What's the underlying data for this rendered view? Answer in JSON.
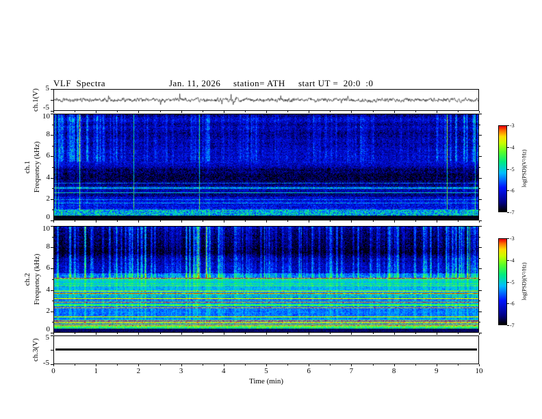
{
  "figure": {
    "title": "VLF  Spectra",
    "date": "Jan. 11, 2026",
    "station_label": "station= ATH",
    "start_ut_label": "start UT =  20:0  :0"
  },
  "axes": {
    "time": {
      "label": "Time (min)",
      "min": 0,
      "max": 10,
      "major_ticks": [
        0,
        1,
        2,
        3,
        4,
        5,
        6,
        7,
        8,
        9,
        10
      ],
      "minor_step": 0.5
    },
    "frequency": {
      "label": "Frequency (kHz)",
      "min": 0,
      "max": 10,
      "major_ticks": [
        0,
        2,
        4,
        6,
        8,
        10
      ],
      "minor_ticks": [
        1,
        3,
        5,
        7,
        9
      ]
    },
    "voltage": {
      "min": -5,
      "max": 5,
      "max_label": "5",
      "min_label": "-5"
    }
  },
  "panels": {
    "ch1_wave": {
      "ylabel": "ch.1(V)"
    },
    "ch1_spec": {
      "ylabel_channel": "ch.1",
      "ylabel_axis": "Frequency (kHz)"
    },
    "ch2_spec": {
      "ylabel_channel": "ch.2",
      "ylabel_axis": "Frequency (kHz)"
    },
    "ch3_wave": {
      "ylabel": "ch.3(V)"
    }
  },
  "colorbar": {
    "label": "log(PSD)(V²/Hz)",
    "max": -3,
    "min": -7,
    "ticks": [
      -3,
      -4,
      -5,
      -6,
      -7
    ]
  },
  "chart_data": [
    {
      "panel": "ch.1(V) waveform",
      "type": "line",
      "xlabel": "Time (min)",
      "xlim": [
        0,
        10
      ],
      "ylabel": "ch.1(V)",
      "ylim": [
        -5,
        5
      ],
      "series": [
        {
          "name": "ch.1 voltage",
          "summary": "zero-mean broadband noise, typical amplitude about ±1 V, with frequent impulsive sferic spikes reaching ±3 to ±5 V; dense spike cluster near t≈4.2 min"
        }
      ]
    },
    {
      "panel": "ch.1 spectrogram",
      "type": "heatmap",
      "xlabel": "Time (min)",
      "xlim": [
        0,
        10
      ],
      "ylabel": "Frequency (kHz)",
      "ylim": [
        0,
        10
      ],
      "zlabel": "log(PSD)(V²/Hz)",
      "zlim": [
        -7,
        -3
      ],
      "features": [
        "very dark background (≈ -6.8) above ~5.5 kHz pierced by dense vertical sferic streaks reaching ≈ -4.5 (cyan/green)",
        "blue background (≈ -6.3) from 1–5.5 kHz with a darker navy band 3–5.5 kHz and scattered cyan-green speckle (≈ -5.5)",
        "a few thin bright horizontal lines between 1.5 and 5 kHz",
        "bright green speckled band near 0.5–0.9 kHz (≈ -5.2)",
        "solid black band (≈ -7) below ~0.4 kHz"
      ]
    },
    {
      "panel": "ch.2 spectrogram",
      "type": "heatmap",
      "xlabel": "Time (min)",
      "xlim": [
        0,
        10
      ],
      "ylabel": "Frequency (kHz)",
      "ylim": [
        0,
        10
      ],
      "zlabel": "log(PSD)(V²/Hz)",
      "zlim": [
        -7,
        -3
      ],
      "features": [
        "very dark background above ~5 kHz with the same dense vertical sferic streaks as ch.1",
        "0.5–5 kHz filled with horizontal harmonic lines in green/yellow/orange (≈ -5 to -3.8) over a cyan-green noisy background",
        "several intense red/orange lines (≈ -3.3) between 0.6 and 4 kHz",
        "bright green line near 0.4–0.5 kHz",
        "dark band (≈ -6.8) below ~0.3 kHz"
      ]
    },
    {
      "panel": "ch.3(V) waveform",
      "type": "line",
      "xlabel": "Time (min)",
      "xlim": [
        0,
        10
      ],
      "ylabel": "ch.3(V)",
      "ylim": [
        -5,
        5
      ],
      "constant_value": 0,
      "series": [
        {
          "name": "ch.3 voltage",
          "summary": "constant 0 V for the whole record, drawn as a thick black flat line (channel inactive)"
        }
      ]
    }
  ],
  "render": {
    "seed": 113,
    "colormap_stops": [
      [
        0.0,
        [
          0,
          0,
          0
        ]
      ],
      [
        0.1,
        [
          0,
          0,
          130
        ]
      ],
      [
        0.28,
        [
          0,
          20,
          255
        ]
      ],
      [
        0.45,
        [
          0,
          190,
          255
        ]
      ],
      [
        0.58,
        [
          0,
          235,
          130
        ]
      ],
      [
        0.7,
        [
          90,
          255,
          40
        ]
      ],
      [
        0.8,
        [
          200,
          255,
          0
        ]
      ],
      [
        0.88,
        [
          255,
          220,
          0
        ]
      ],
      [
        0.95,
        [
          255,
          110,
          0
        ]
      ],
      [
        1.0,
        [
          235,
          0,
          0
        ]
      ]
    ]
  }
}
